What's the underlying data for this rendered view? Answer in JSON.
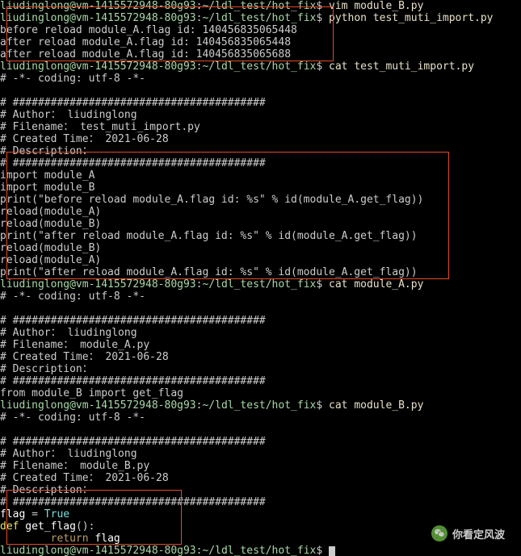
{
  "prompt": {
    "user": "liudinglong",
    "host": "vm-1415572948-80g93",
    "path": "~/ldl_test/hot_fix",
    "sep1": "@",
    "sep2": ":",
    "dollar": "$ "
  },
  "lines": [
    {
      "type": "prompt",
      "cmd": "vim module_B.py"
    },
    {
      "type": "prompt",
      "cmd": "python test_muti_import.py"
    },
    {
      "type": "out",
      "text": "before reload module_A.flag id: 140456835065448"
    },
    {
      "type": "out",
      "text": "after reload module_A.flag id: 140456835065448"
    },
    {
      "type": "out",
      "text": "after reload module_A.flag id: 140456835065688"
    },
    {
      "type": "prompt",
      "cmd": "cat test_muti_import.py"
    },
    {
      "type": "out",
      "text": "# -*- coding: utf-8 -*-"
    },
    {
      "type": "out",
      "text": ""
    },
    {
      "type": "out",
      "text": "# ########################################"
    },
    {
      "type": "out",
      "text": "# Author： liudinglong"
    },
    {
      "type": "out",
      "text": "# Filename： test_muti_import.py"
    },
    {
      "type": "out",
      "text": "# Created Time： 2021-06-28"
    },
    {
      "type": "out",
      "text": "# Description："
    },
    {
      "type": "out",
      "text": "# ########################################"
    },
    {
      "type": "out",
      "text": "import module_A"
    },
    {
      "type": "out",
      "text": "import module_B"
    },
    {
      "type": "out",
      "text": "print(\"before reload module_A.flag id: %s\" % id(module_A.get_flag))"
    },
    {
      "type": "out",
      "text": "reload(module_A)"
    },
    {
      "type": "out",
      "text": "reload(module_B)"
    },
    {
      "type": "out",
      "text": "print(\"after reload module_A.flag id: %s\" % id(module_A.get_flag))"
    },
    {
      "type": "out",
      "text": "reload(module_B)"
    },
    {
      "type": "out",
      "text": "reload(module_A)"
    },
    {
      "type": "out",
      "text": "print(\"after reload module_A.flag id: %s\" % id(module_A.get_flag))"
    },
    {
      "type": "prompt",
      "cmd": "cat module_A.py"
    },
    {
      "type": "out",
      "text": "# -*- coding: utf-8 -*-"
    },
    {
      "type": "out",
      "text": ""
    },
    {
      "type": "out",
      "text": "# ########################################"
    },
    {
      "type": "out",
      "text": "# Author： liudinglong"
    },
    {
      "type": "out",
      "text": "# Filename： module_A.py"
    },
    {
      "type": "out",
      "text": "# Created Time： 2021-06-28"
    },
    {
      "type": "out",
      "text": "# Description："
    },
    {
      "type": "out",
      "text": "# ########################################"
    },
    {
      "type": "out",
      "text": "from module_B import get_flag"
    },
    {
      "type": "prompt",
      "cmd": "cat module_B.py"
    },
    {
      "type": "out",
      "text": "# -*- coding: utf-8 -*-"
    },
    {
      "type": "out",
      "text": ""
    },
    {
      "type": "out",
      "text": "# ########################################"
    },
    {
      "type": "out",
      "text": "# Author： liudinglong"
    },
    {
      "type": "out",
      "text": "# Filename： module_B.py"
    },
    {
      "type": "out",
      "text": "# Created Time： 2021-06-28"
    },
    {
      "type": "out",
      "text": "# Description："
    },
    {
      "type": "out",
      "text": "# ########################################"
    },
    {
      "type": "code_flag"
    },
    {
      "type": "code_def"
    },
    {
      "type": "code_return"
    },
    {
      "type": "prompt_cursor"
    }
  ],
  "code": {
    "flag_kw": "flag",
    "eq": " = ",
    "true": "True",
    "def": "def",
    "get_flag": " get_flag",
    "paren": "():",
    "indent": "        ",
    "return": "return",
    "flag_ret": " flag"
  },
  "watermark": "你看定风波"
}
